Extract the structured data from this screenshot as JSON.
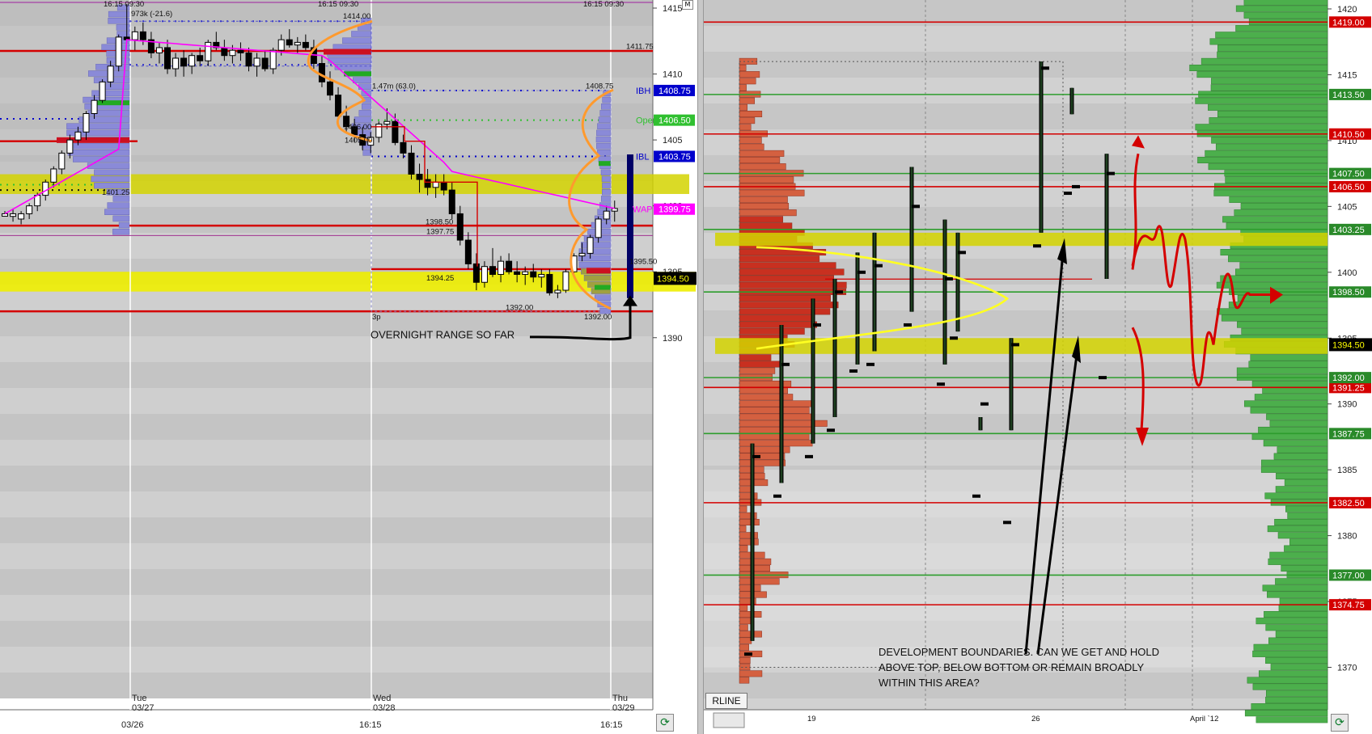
{
  "colors": {
    "red": "#d40000",
    "green": "#2e9d2e",
    "ibh": "#0000cc",
    "open": "#30c030",
    "vwap": "#ff00ff",
    "yellow_band": "#d4d400",
    "bright_yellow": "#eeee00",
    "orange": "#ff9a2e",
    "profile_blue": "#8a8ad8",
    "profile_red": "#d46040",
    "profile_green": "#4caf4c"
  },
  "chart_data": [
    {
      "type": "candlestick",
      "name_hint": "left",
      "ylim": [
        1388.5,
        1415.5
      ],
      "price_ticks": [
        1415,
        1410,
        1405,
        1400,
        1395,
        1390
      ],
      "x_axis": {
        "day_labels": [
          {
            "day": "Tue",
            "date": "03/27"
          },
          {
            "day": "Wed",
            "date": "03/28"
          },
          {
            "day": "Thu",
            "date": "03/29"
          }
        ],
        "bottom_labels": [
          "03/26",
          "16:15",
          "16:15"
        ],
        "top_labels": [
          "16:15  09:30",
          "16:15  09:30",
          "16:15  09:30"
        ]
      },
      "candles": [
        [
          1399.4,
          1399.6,
          1399.2,
          1399.4
        ],
        [
          1399.2,
          1399.8,
          1398.8,
          1399.4
        ],
        [
          1399.0,
          1399.6,
          1398.6,
          1399.4
        ],
        [
          1399.4,
          1400.2,
          1399.0,
          1400.0
        ],
        [
          1400.0,
          1401.0,
          1399.6,
          1400.8
        ],
        [
          1400.8,
          1402.0,
          1400.4,
          1401.8
        ],
        [
          1401.8,
          1403.0,
          1401.4,
          1402.8
        ],
        [
          1402.8,
          1404.2,
          1402.4,
          1404.0
        ],
        [
          1404.0,
          1405.4,
          1403.6,
          1405.0
        ],
        [
          1405.0,
          1406.0,
          1404.6,
          1405.6
        ],
        [
          1405.6,
          1407.2,
          1405.0,
          1407.0
        ],
        [
          1407.0,
          1408.4,
          1406.6,
          1408.0
        ],
        [
          1408.0,
          1409.6,
          1407.8,
          1409.4
        ],
        [
          1409.4,
          1411.0,
          1409.0,
          1410.6
        ],
        [
          1410.6,
          1413.0,
          1410.2,
          1412.8
        ],
        [
          1412.8,
          1415.3,
          1412.4,
          1412.6
        ],
        [
          1412.6,
          1413.6,
          1411.8,
          1413.2
        ],
        [
          1413.2,
          1413.9,
          1412.2,
          1412.6
        ],
        [
          1412.6,
          1413.2,
          1411.2,
          1411.6
        ],
        [
          1411.6,
          1412.4,
          1410.8,
          1412.0
        ],
        [
          1412.0,
          1412.6,
          1410.0,
          1410.4
        ],
        [
          1410.4,
          1411.6,
          1409.8,
          1411.2
        ],
        [
          1411.2,
          1411.8,
          1409.8,
          1410.6
        ],
        [
          1410.6,
          1411.6,
          1410.0,
          1411.4
        ],
        [
          1411.4,
          1412.0,
          1410.6,
          1411.0
        ],
        [
          1411.0,
          1412.6,
          1410.6,
          1412.4
        ],
        [
          1412.4,
          1413.2,
          1411.8,
          1412.0
        ],
        [
          1412.0,
          1412.6,
          1411.0,
          1411.4
        ],
        [
          1411.4,
          1412.2,
          1410.8,
          1411.8
        ],
        [
          1411.8,
          1412.4,
          1411.0,
          1411.6
        ],
        [
          1411.6,
          1412.0,
          1410.2,
          1410.6
        ],
        [
          1410.6,
          1411.6,
          1409.8,
          1411.2
        ],
        [
          1411.2,
          1411.8,
          1410.2,
          1410.4
        ],
        [
          1410.4,
          1412.0,
          1410.0,
          1411.8
        ],
        [
          1411.8,
          1413.0,
          1411.4,
          1412.6
        ],
        [
          1412.6,
          1413.4,
          1412.0,
          1412.2
        ],
        [
          1412.2,
          1412.8,
          1411.6,
          1412.4
        ],
        [
          1412.4,
          1413.0,
          1411.8,
          1412.0
        ],
        [
          1412.0,
          1412.6,
          1410.4,
          1410.8
        ],
        [
          1410.8,
          1411.4,
          1409.0,
          1409.4
        ],
        [
          1409.4,
          1410.2,
          1408.0,
          1408.4
        ],
        [
          1408.4,
          1409.0,
          1406.4,
          1406.8
        ],
        [
          1406.8,
          1407.6,
          1405.6,
          1406.0
        ],
        [
          1406.0,
          1406.6,
          1404.8,
          1405.4
        ],
        [
          1405.4,
          1406.0,
          1404.2,
          1404.6
        ],
        [
          1404.6,
          1405.6,
          1404.0,
          1405.2
        ],
        [
          1405.2,
          1406.4,
          1404.8,
          1406.2
        ],
        [
          1406.2,
          1407.4,
          1405.8,
          1406.4
        ],
        [
          1406.4,
          1407.0,
          1404.6,
          1404.8
        ],
        [
          1404.8,
          1405.4,
          1403.6,
          1404.0
        ],
        [
          1404.0,
          1404.6,
          1402.0,
          1402.4
        ],
        [
          1402.4,
          1403.2,
          1401.0,
          1402.0
        ],
        [
          1402.0,
          1402.8,
          1400.8,
          1401.4
        ],
        [
          1401.4,
          1402.4,
          1400.6,
          1401.8
        ],
        [
          1401.8,
          1402.4,
          1400.8,
          1401.2
        ],
        [
          1401.2,
          1401.8,
          1399.0,
          1399.4
        ],
        [
          1399.4,
          1400.0,
          1397.0,
          1397.4
        ],
        [
          1397.4,
          1398.0,
          1395.2,
          1395.6
        ],
        [
          1395.6,
          1396.4,
          1393.6,
          1394.2
        ],
        [
          1394.2,
          1395.8,
          1393.8,
          1395.4
        ],
        [
          1395.4,
          1396.8,
          1394.6,
          1394.8
        ],
        [
          1394.8,
          1396.2,
          1394.2,
          1395.8
        ],
        [
          1395.8,
          1396.4,
          1394.8,
          1395.0
        ],
        [
          1395.0,
          1395.8,
          1394.2,
          1394.8
        ],
        [
          1394.8,
          1395.4,
          1394.0,
          1395.0
        ],
        [
          1395.0,
          1395.6,
          1394.2,
          1394.6
        ],
        [
          1394.6,
          1395.2,
          1393.8,
          1394.8
        ],
        [
          1394.8,
          1395.2,
          1393.2,
          1393.4
        ],
        [
          1393.4,
          1394.0,
          1393.0,
          1393.6
        ],
        [
          1393.6,
          1395.2,
          1393.4,
          1395.0
        ],
        [
          1395.0,
          1396.4,
          1394.6,
          1396.2
        ],
        [
          1396.2,
          1397.2,
          1395.8,
          1396.4
        ],
        [
          1396.4,
          1397.8,
          1396.0,
          1397.6
        ],
        [
          1397.6,
          1399.2,
          1397.2,
          1399.0
        ],
        [
          1399.0,
          1400.0,
          1398.6,
          1399.6
        ],
        [
          1399.6,
          1400.4,
          1398.8,
          1399.8
        ]
      ],
      "vwap_label": "WAP",
      "vwap_value": "1399.75",
      "last_price": "1394.50",
      "markers": [
        {
          "label": "IBH",
          "value": "1408.75",
          "price": 1408.75,
          "color": "#0000cc"
        },
        {
          "label": "Open",
          "value": "1406.50",
          "price": 1406.5,
          "color": "#30c030"
        },
        {
          "label": "IBL",
          "value": "1403.75",
          "price": 1403.75,
          "color": "#0000cc"
        }
      ],
      "level_labels": [
        "973k (-21.6)",
        "1414.00",
        "1411.75",
        "1.47m (63.0)",
        "1408.75",
        "1406.00",
        "1405.00",
        "1401.25",
        "1398.50",
        "1397.75",
        "1395.50",
        "1394.25",
        "1392.00",
        "1392.00",
        "3p"
      ],
      "annotation": "OVERNIGHT RANGE SO FAR"
    },
    {
      "type": "bar",
      "name_hint": "right",
      "ylim": [
        1367.5,
        1421.0
      ],
      "price_ticks": [
        1420,
        1415,
        1410,
        1405,
        1400,
        1395,
        1390,
        1385,
        1380,
        1375,
        1370
      ],
      "x_labels": [
        "19",
        "26",
        "April `12"
      ],
      "bars": [
        [
          1371.0,
          1387.0,
          1372.0,
          1386.0
        ],
        [
          1383.0,
          1396.0,
          1384.0,
          1393.0
        ],
        [
          1386.0,
          1398.0,
          1387.0,
          1396.0
        ],
        [
          1388.0,
          1399.5,
          1389.0,
          1398.5
        ],
        [
          1392.5,
          1401.5,
          1393.0,
          1400.0
        ],
        [
          1393.0,
          1403.0,
          1394.0,
          1400.5
        ],
        [
          1396.0,
          1408.0,
          1397.0,
          1405.0
        ],
        [
          1391.5,
          1404.0,
          1393.0,
          1399.5
        ],
        [
          1395.0,
          1403.0,
          1395.5,
          1401.5
        ],
        [
          1383.0,
          1389.0,
          1388.0,
          1390.0
        ],
        [
          1381.0,
          1395.0,
          1388.0,
          1394.5
        ],
        [
          1402.0,
          1416.0,
          1403.0,
          1415.5
        ],
        [
          1406.0,
          1414.0,
          1412.0,
          1406.5
        ],
        [
          1392.0,
          1409.0,
          1399.5,
          1407.5
        ]
      ],
      "red_levels": [
        {
          "price": 1419.0,
          "label": "1419.00"
        },
        {
          "price": 1410.5,
          "label": "1410.50"
        },
        {
          "price": 1406.5,
          "label": "1406.50"
        },
        {
          "price": 1391.25,
          "label": "1391.25"
        },
        {
          "price": 1382.5,
          "label": "1382.50"
        },
        {
          "price": 1374.75,
          "label": "1374.75"
        }
      ],
      "green_levels": [
        {
          "price": 1413.5,
          "label": "1413.50"
        },
        {
          "price": 1407.5,
          "label": "1407.50"
        },
        {
          "price": 1403.25,
          "label": "1403.25"
        },
        {
          "price": 1398.5,
          "label": "1398.50"
        },
        {
          "price": 1392.0,
          "label": "1392.00"
        },
        {
          "price": 1387.75,
          "label": "1387.75"
        },
        {
          "price": 1377.0,
          "label": "1377.00"
        }
      ],
      "last_price": "1394.50",
      "annotation": [
        "DEVELOPMENT BOUNDARIES. CAN WE GET AND HOLD",
        "ABOVE TOP, BELOW BOTTOM OR REMAIN BROADLY",
        "WITHIN THIS AREA?"
      ],
      "button": "RLINE"
    }
  ]
}
